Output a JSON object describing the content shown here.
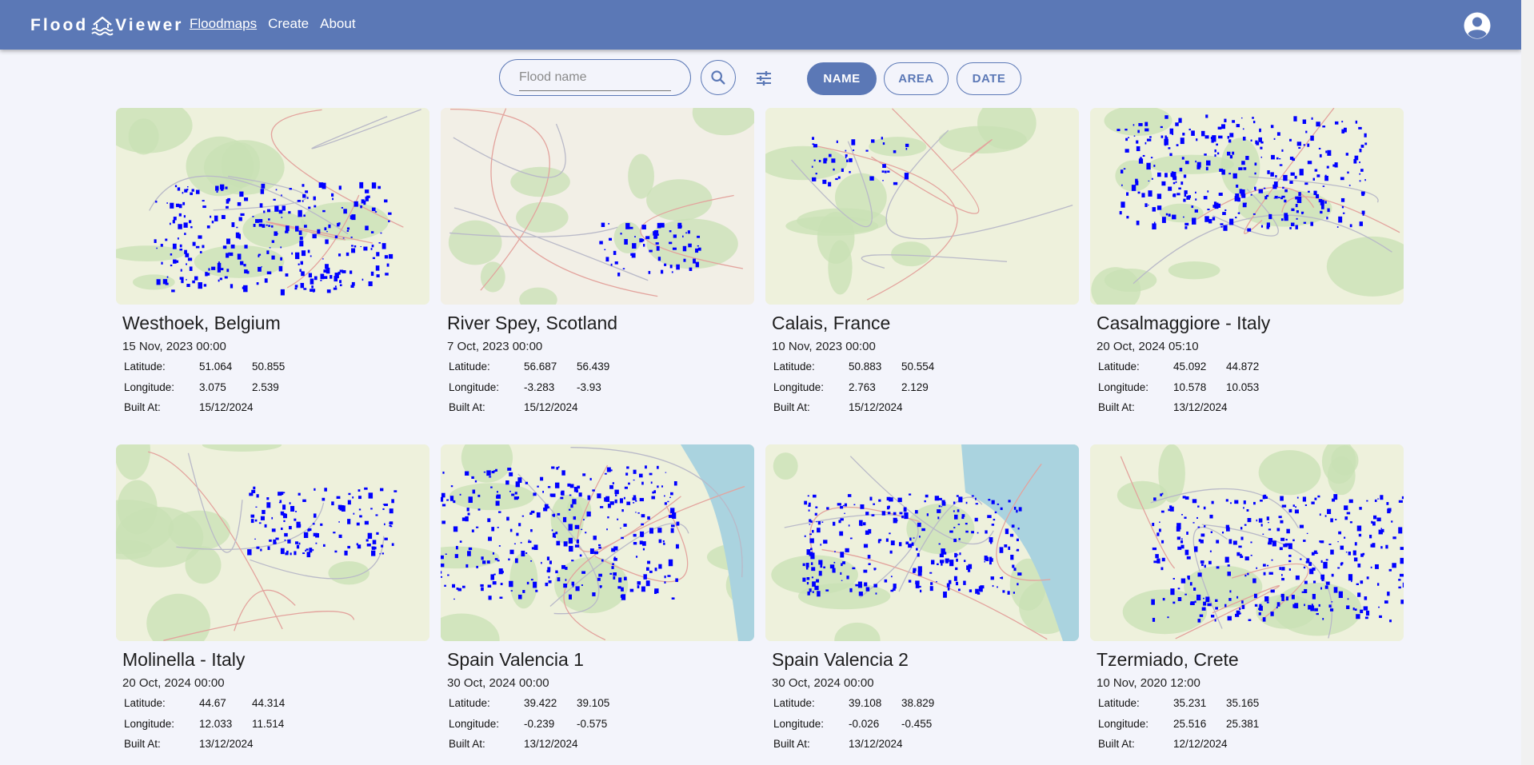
{
  "app": {
    "brand_left": "Flood",
    "brand_right": "Viewer",
    "nav": [
      "Floodmaps",
      "Create",
      "About"
    ],
    "active_nav": "Floodmaps"
  },
  "icons": {
    "brand": "wave-house-icon",
    "search": "search-icon",
    "filter": "tune-sliders-icon",
    "avatar": "account-circle-icon"
  },
  "colors": {
    "header": "#5b78b6",
    "flood": "#0000ff",
    "page_bg": "#f3f4fb"
  },
  "search": {
    "placeholder": "Flood name",
    "value": ""
  },
  "sort": {
    "options": [
      "NAME",
      "AREA",
      "DATE"
    ],
    "selected": "NAME"
  },
  "labels": {
    "latitude": "Latitude:",
    "longitude": "Longitude:",
    "built_at": "Built At:"
  },
  "floodmaps": [
    {
      "name": "Westhoek, Belgium",
      "date": "15 Nov, 2023 00:00",
      "lat": [
        "51.064",
        "50.855"
      ],
      "lon": [
        "3.075",
        "2.539"
      ],
      "built": "15/12/2024",
      "flood_level": 0.55
    },
    {
      "name": "River Spey, Scotland",
      "date": "7 Oct, 2023 00:00",
      "lat": [
        "56.687",
        "56.439"
      ],
      "lon": [
        "-3.283",
        "-3.93"
      ],
      "built": "15/12/2024",
      "flood_level": 0.12
    },
    {
      "name": "Calais, France",
      "date": "10 Nov, 2023 00:00",
      "lat": [
        "50.883",
        "50.554"
      ],
      "lon": [
        "2.763",
        "2.129"
      ],
      "built": "15/12/2024",
      "flood_level": 0.08
    },
    {
      "name": "Casalmaggiore - Italy",
      "date": "20 Oct, 2024 05:10",
      "lat": [
        "45.092",
        "44.872"
      ],
      "lon": [
        "10.578",
        "10.053"
      ],
      "built": "13/12/2024",
      "flood_level": 0.6
    },
    {
      "name": "Molinella - Italy",
      "date": "20 Oct, 2024 00:00",
      "lat": [
        "44.67",
        "44.314"
      ],
      "lon": [
        "12.033",
        "11.514"
      ],
      "built": "13/12/2024",
      "flood_level": 0.25
    },
    {
      "name": "Spain Valencia 1",
      "date": "30 Oct, 2024 00:00",
      "lat": [
        "39.422",
        "39.105"
      ],
      "lon": [
        "-0.239",
        "-0.575"
      ],
      "built": "13/12/2024",
      "flood_level": 0.75
    },
    {
      "name": "Spain Valencia 2",
      "date": "30 Oct, 2024 00:00",
      "lat": [
        "39.108",
        "38.829"
      ],
      "lon": [
        "-0.026",
        "-0.455"
      ],
      "built": "13/12/2024",
      "flood_level": 0.5
    },
    {
      "name": "Tzermiado, Crete",
      "date": "10 Nov, 2020 12:00",
      "lat": [
        "35.231",
        "35.165"
      ],
      "lon": [
        "25.516",
        "25.381"
      ],
      "built": "12/12/2024",
      "flood_level": 0.7
    }
  ]
}
